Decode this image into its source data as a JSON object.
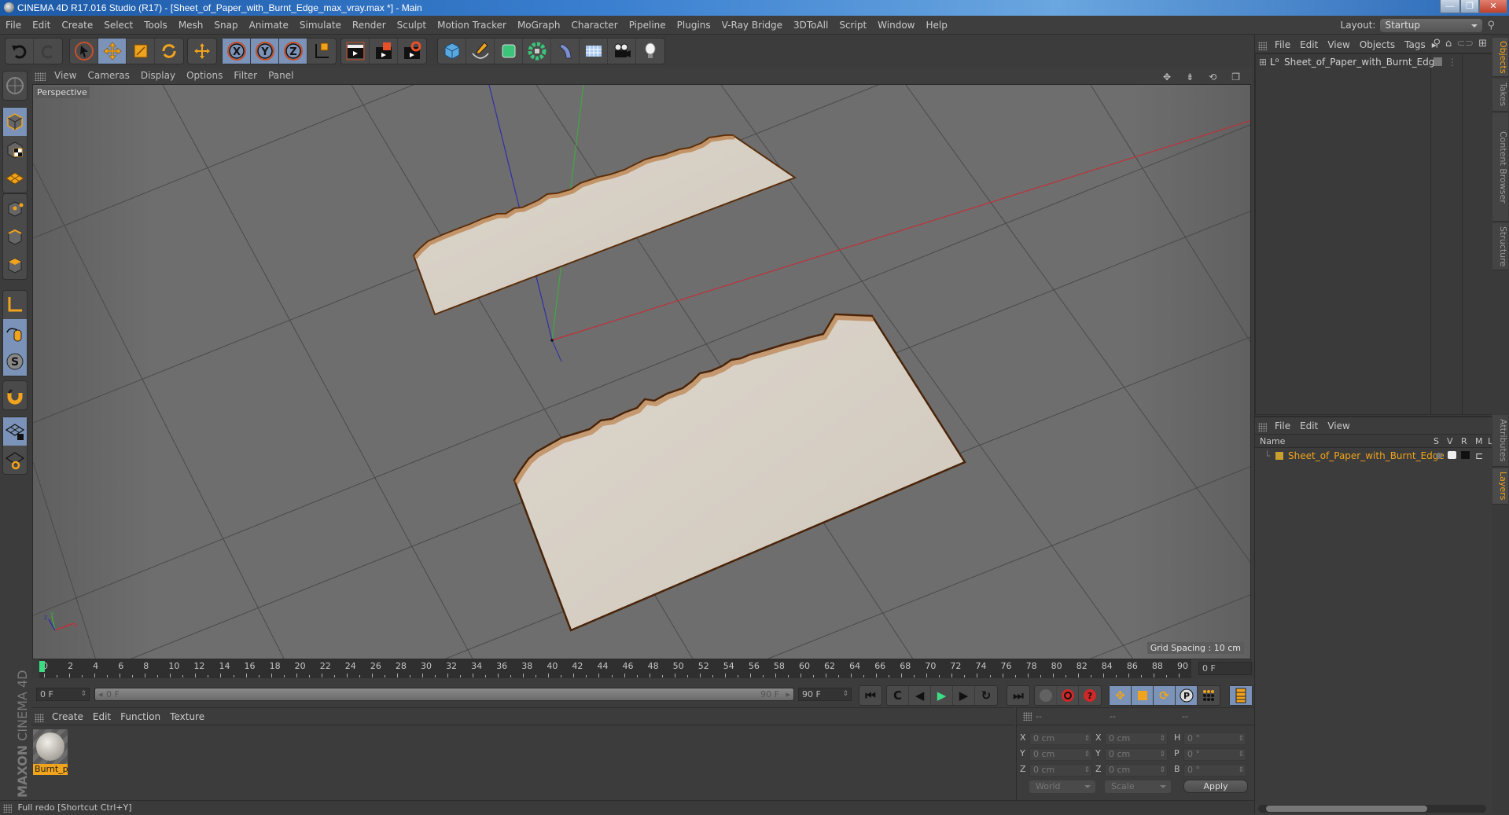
{
  "window": {
    "title": "CINEMA 4D R17.016 Studio (R17) - [Sheet_of_Paper_with_Burnt_Edge_max_vray.max *] - Main",
    "minimize": "—",
    "restore": "❐",
    "close": "✕"
  },
  "menubar": {
    "items": [
      "File",
      "Edit",
      "Create",
      "Select",
      "Tools",
      "Mesh",
      "Snap",
      "Animate",
      "Simulate",
      "Render",
      "Sculpt",
      "Motion Tracker",
      "MoGraph",
      "Character",
      "Pipeline",
      "Plugins",
      "V-Ray Bridge",
      "3DToAll",
      "Script",
      "Window",
      "Help"
    ],
    "layout_label": "Layout:",
    "layout_value": "Startup"
  },
  "toolbar": {
    "icons": [
      "undo-icon",
      "redo-icon",
      "live-selection-icon",
      "move-icon",
      "scale-icon",
      "rotate-icon",
      "recent-tool-icon",
      "x-axis-icon",
      "y-axis-icon",
      "z-axis-icon",
      "coordinate-system-icon",
      "render-view-icon",
      "render-picture-viewer-icon",
      "render-settings-icon",
      "cube-icon",
      "pen-spline-icon",
      "subdivision-icon",
      "cloner-icon",
      "deformer-icon",
      "floor-icon",
      "camera-icon",
      "light-icon"
    ],
    "axis_labels": {
      "x": "X",
      "y": "Y",
      "z": "Z"
    }
  },
  "left_toolbar": {
    "icons": [
      "make-editable-icon",
      "model-mode-icon",
      "texture-mode-icon",
      "workplane-mode-icon",
      "points-mode-icon",
      "edges-mode-icon",
      "polygons-mode-icon",
      "axis-mode-icon",
      "tweak-mode-icon",
      "solo-mode-icon",
      "snap-magnet-icon",
      "workplane-lock-icon",
      "workplane-align-icon"
    ]
  },
  "viewport": {
    "menu": [
      "View",
      "Cameras",
      "Display",
      "Options",
      "Filter",
      "Panel"
    ],
    "label": "Perspective",
    "grid_spacing": "Grid Spacing : 10 cm",
    "axis_colors": {
      "x": "#c0303a",
      "y": "#3fa83f",
      "z": "#3030a8"
    }
  },
  "timeline": {
    "start_marker": "0",
    "ticks": [
      0,
      2,
      4,
      6,
      8,
      10,
      12,
      14,
      16,
      18,
      20,
      22,
      24,
      26,
      28,
      30,
      32,
      34,
      36,
      38,
      40,
      42,
      44,
      46,
      48,
      50,
      52,
      54,
      56,
      58,
      60,
      62,
      64,
      66,
      68,
      70,
      72,
      74,
      76,
      78,
      80,
      82,
      84,
      86,
      88,
      90
    ],
    "current_frame": "0 F",
    "min_frame": "0 F",
    "range_start": "0 F",
    "range_end": "90 F",
    "max_frame": "90 F"
  },
  "transport": {
    "first": "⏮",
    "prev_key": "C",
    "prev_frame": "◀",
    "play": "▶",
    "next_frame": "▶",
    "next_key": "↻",
    "last": "⏭"
  },
  "material_manager": {
    "menu": [
      "Create",
      "Edit",
      "Function",
      "Texture"
    ],
    "materials": [
      {
        "name": "Burnt_p"
      }
    ]
  },
  "branding": {
    "maxon": "MAXON",
    "product": "CINEMA 4D"
  },
  "coordinates": {
    "headers": [
      "--",
      "--",
      "--"
    ],
    "rows": [
      {
        "pos_label": "X",
        "pos": "0 cm",
        "size_label": "X",
        "size": "0 cm",
        "rot_label": "H",
        "rot": "0 °"
      },
      {
        "pos_label": "Y",
        "pos": "0 cm",
        "size_label": "Y",
        "size": "0 cm",
        "rot_label": "P",
        "rot": "0 °"
      },
      {
        "pos_label": "Z",
        "pos": "0 cm",
        "size_label": "Z",
        "size": "0 cm",
        "rot_label": "B",
        "rot": "0 °"
      }
    ],
    "space": "World",
    "mode": "Scale",
    "apply": "Apply"
  },
  "status": "Full redo [Shortcut Ctrl+Y]",
  "object_manager": {
    "menu": [
      "File",
      "Edit",
      "View",
      "Objects",
      "Tags"
    ],
    "objects": [
      {
        "name": "Sheet_of_Paper_with_Burnt_Edge"
      }
    ]
  },
  "layer_manager": {
    "menu": [
      "File",
      "Edit",
      "View"
    ],
    "columns": [
      "Name",
      "S",
      "V",
      "R",
      "M",
      "L"
    ],
    "layers": [
      {
        "name": "Sheet_of_Paper_with_Burnt_Edge",
        "color": "#c8a030"
      }
    ]
  },
  "side_tabs": [
    "Objects",
    "Takes",
    "Content Browser",
    "Structure",
    "Attributes",
    "Layers"
  ]
}
